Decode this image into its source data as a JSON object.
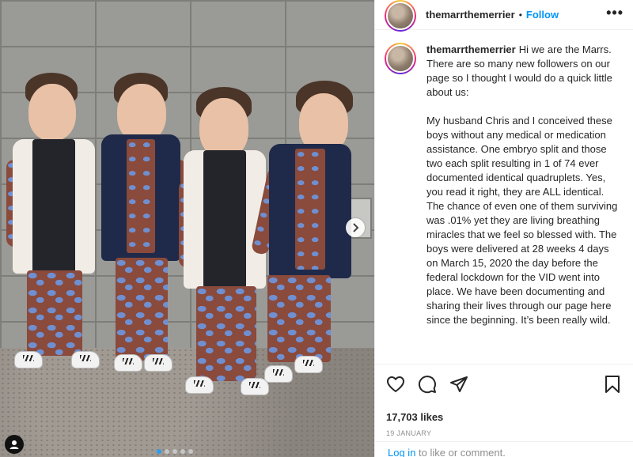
{
  "post": {
    "username": "themarrthemerrier",
    "follow_label": "Follow",
    "bullet": "•",
    "more_label": "•••",
    "caption": "Hi we are the Marrs. There are so many new followers on our page so I thought I would do a quick little about us:\n\nMy husband Chris and I conceived these boys without any medical or medication assistance. One embryo split and those two each split resulting in 1 of 74 ever documented identical quadruplets. Yes, you read it right, they are ALL identical. The chance of even one of them surviving was .01% yet they are living breathing miracles that we feel so blessed with. The boys were delivered at 28 weeks 4 days on March 15, 2020 the day before the federal lockdown for the VID went into place. We have been documenting and sharing their lives through our page here since the beginning. It’s been really wild.",
    "likes": "17,703 likes",
    "date": "19 JANUARY"
  },
  "footer": {
    "login_link": "Log in",
    "login_suffix": " to like or comment."
  },
  "carousel": {
    "slide_count": 5,
    "active_index": 0,
    "next_icon": "chevron-right-icon"
  },
  "icons": {
    "like": "heart-icon",
    "comment": "comment-icon",
    "share": "paper-plane-icon",
    "save": "bookmark-icon",
    "tag": "user-tag-icon"
  },
  "colors": {
    "accent": "#0095f6",
    "muted": "#8e8e8e",
    "text": "#262626"
  }
}
